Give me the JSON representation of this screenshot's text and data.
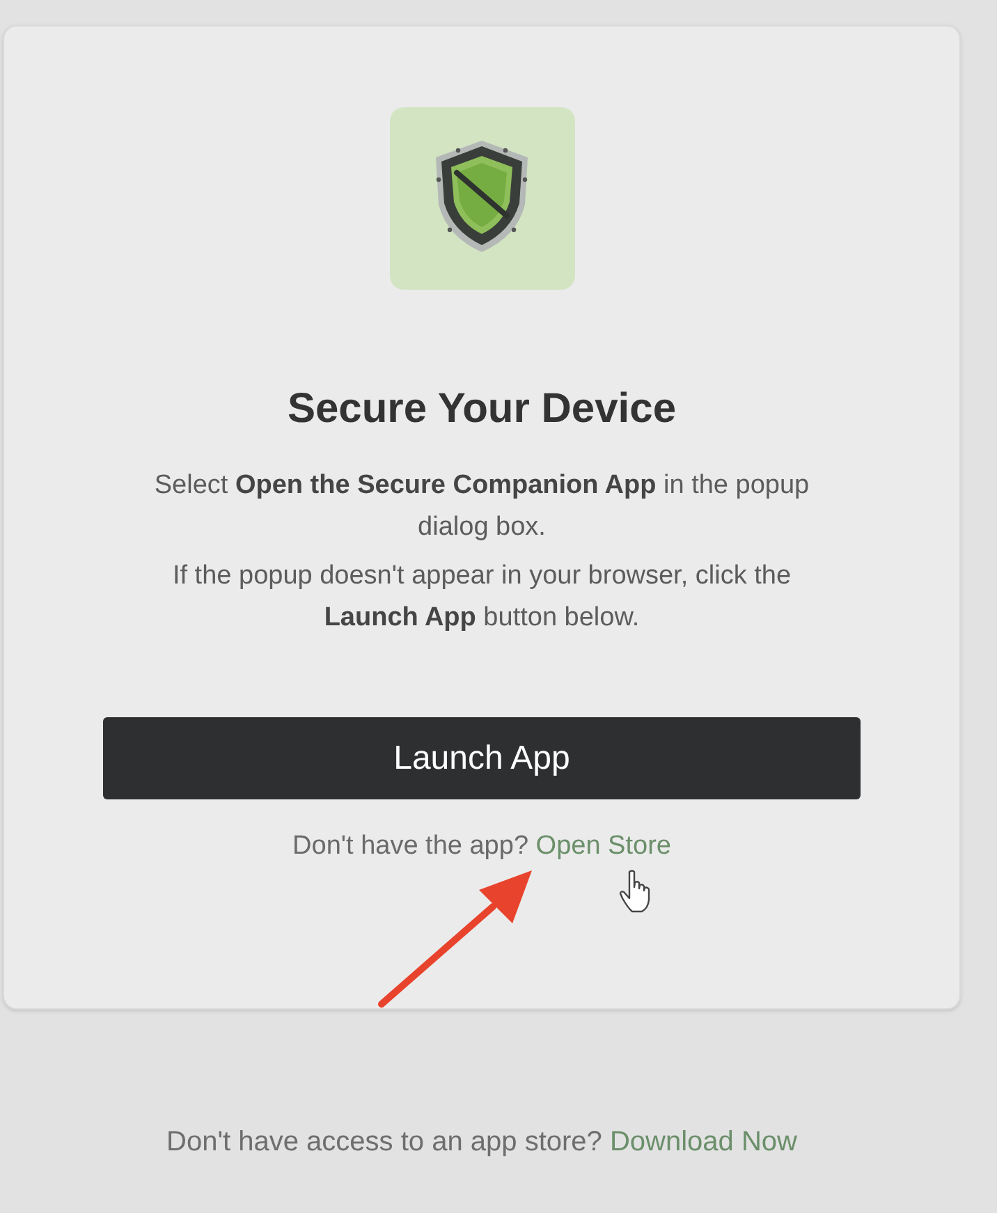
{
  "title": "Secure Your Device",
  "instructions": [
    "Select **Open the Secure Companion App** in the popup dialog box.",
    "If the popup doesn't appear in your browser, click the **Launch App** button below."
  ],
  "launch_button": {
    "label": "Launch App"
  },
  "store_prompt": {
    "text": "Don't have the app?",
    "link": "Open Store"
  },
  "footer": {
    "text": "Don't have access to an app store?",
    "link": "Download Now"
  }
}
